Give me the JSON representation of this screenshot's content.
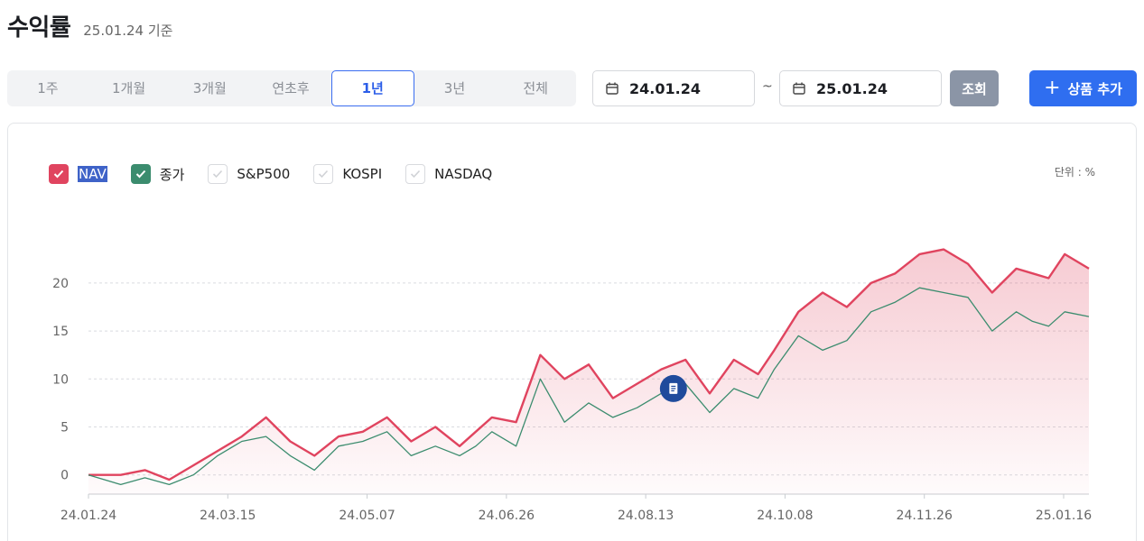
{
  "header": {
    "title": "수익률",
    "basis": "25.01.24 기준"
  },
  "period_tabs": [
    {
      "label": "1주",
      "active": false
    },
    {
      "label": "1개월",
      "active": false
    },
    {
      "label": "3개월",
      "active": false
    },
    {
      "label": "연초후",
      "active": false
    },
    {
      "label": "1년",
      "active": true
    },
    {
      "label": "3년",
      "active": false
    },
    {
      "label": "전체",
      "active": false
    }
  ],
  "date_range": {
    "start": "24.01.24",
    "end": "25.01.24",
    "separator": "~"
  },
  "buttons": {
    "search": "조회",
    "add_product": "상품 추가"
  },
  "icons": {
    "calendar": "calendar-icon",
    "check": "check-icon",
    "plus": "plus-icon",
    "event_marker": "document-icon"
  },
  "colors": {
    "accent": "#2f6ef0",
    "nav": "#e0445f",
    "close": "#3b8c6e",
    "marker": "#1f4b9c"
  },
  "legend": [
    {
      "label": "NAV",
      "checked": true,
      "color": "#e0445f"
    },
    {
      "label": "종가",
      "checked": true,
      "color": "#3b8c6e"
    },
    {
      "label": "S&P500",
      "checked": false
    },
    {
      "label": "KOSPI",
      "checked": false
    },
    {
      "label": "NASDAQ",
      "checked": false
    }
  ],
  "unit_label": "단위 : %",
  "chart_data": {
    "type": "area",
    "title": "",
    "xlabel": "",
    "ylabel": "",
    "x_tick_labels": [
      "24.01.24",
      "24.03.15",
      "24.05.07",
      "24.06.26",
      "24.08.13",
      "24.10.08",
      "24.11.26",
      "25.01.16"
    ],
    "y_ticks": [
      0,
      5,
      10,
      15,
      20
    ],
    "ylim": [
      -2,
      26
    ],
    "grid": true,
    "legend_position": "top-left",
    "x_index_range": [
      0,
      248
    ],
    "series": [
      {
        "name": "NAV",
        "color": "#e0445f",
        "fill": true,
        "x": [
          0,
          8,
          14,
          20,
          26,
          32,
          38,
          44,
          50,
          56,
          62,
          68,
          74,
          80,
          86,
          92,
          96,
          100,
          106,
          112,
          118,
          124,
          130,
          136,
          142,
          148,
          154,
          160,
          166,
          170,
          176,
          182,
          188,
          194,
          200,
          206,
          212,
          218,
          224,
          230,
          234,
          238,
          242,
          248
        ],
        "values": [
          0,
          0,
          0.5,
          -0.5,
          1,
          2.5,
          4,
          6,
          3.5,
          2,
          4,
          4.5,
          6,
          3.5,
          5,
          3,
          4.5,
          6,
          5.5,
          12.5,
          10,
          11.5,
          8,
          9.5,
          11,
          12,
          8.5,
          12,
          10.5,
          13,
          17,
          19,
          17.5,
          20,
          21,
          23,
          23.5,
          22,
          19,
          21.5,
          21,
          20.5,
          23,
          21.5
        ]
      },
      {
        "name": "종가",
        "color": "#3b8c6e",
        "fill": false,
        "x": [
          0,
          8,
          14,
          20,
          26,
          32,
          38,
          44,
          50,
          56,
          62,
          68,
          74,
          80,
          86,
          92,
          96,
          100,
          106,
          112,
          118,
          124,
          130,
          136,
          142,
          148,
          154,
          160,
          166,
          170,
          176,
          182,
          188,
          194,
          200,
          206,
          212,
          218,
          224,
          230,
          234,
          238,
          242,
          248
        ],
        "values": [
          0,
          -1,
          -0.3,
          -1,
          0,
          2,
          3.5,
          4,
          2,
          0.5,
          3,
          3.5,
          4.5,
          2,
          3,
          2,
          3,
          4.5,
          3,
          10,
          5.5,
          7.5,
          6,
          7,
          8.5,
          9.5,
          6.5,
          9,
          8,
          11,
          14.5,
          13,
          14,
          17,
          18,
          19.5,
          19,
          18.5,
          15,
          17,
          16,
          15.5,
          17,
          16.5
        ]
      }
    ],
    "annotations": [
      {
        "type": "event-marker",
        "x": 145,
        "y": 9
      }
    ]
  }
}
